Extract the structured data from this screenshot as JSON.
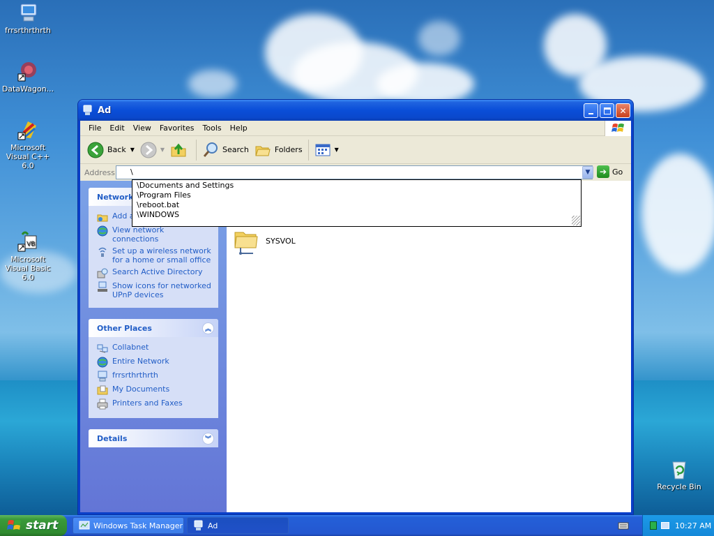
{
  "desktop": {
    "icons": [
      {
        "label": "frrsrthrthrth"
      },
      {
        "label": "DataWagon..."
      },
      {
        "label": "Microsoft Visual C++ 6.0"
      },
      {
        "label": "Microsoft Visual Basic 6.0"
      },
      {
        "label": "Recycle Bin"
      }
    ]
  },
  "window": {
    "title": "Ad",
    "menu": [
      "File",
      "Edit",
      "View",
      "Favorites",
      "Tools",
      "Help"
    ],
    "toolbar": {
      "back": "Back",
      "search": "Search",
      "folders": "Folders"
    },
    "address": {
      "label": "Address",
      "value": "\\",
      "go": "Go"
    },
    "autocomplete": [
      "\\Documents and Settings",
      "\\Program Files",
      "\\reboot.bat",
      "\\WINDOWS"
    ],
    "taskpane": {
      "network_tasks": {
        "title": "Network",
        "items": [
          "Add a",
          "View network connections",
          "Set up a wireless network for a home or small office",
          "Search Active Directory",
          "Show icons for networked UPnP devices"
        ]
      },
      "other_places": {
        "title": "Other Places",
        "items": [
          "Collabnet",
          "Entire Network",
          "frrsrthrthrth",
          "My Documents",
          "Printers and Faxes"
        ]
      },
      "details": {
        "title": "Details"
      }
    },
    "content": {
      "folder": "SYSVOL"
    }
  },
  "taskbar": {
    "start": "start",
    "tasks": [
      "Windows Task Manager",
      "Ad"
    ],
    "clock": "10:27 AM"
  },
  "colors": {
    "link": "#215dc6",
    "titlebar": "#0a4ed8",
    "taskbar": "#2457d0"
  }
}
